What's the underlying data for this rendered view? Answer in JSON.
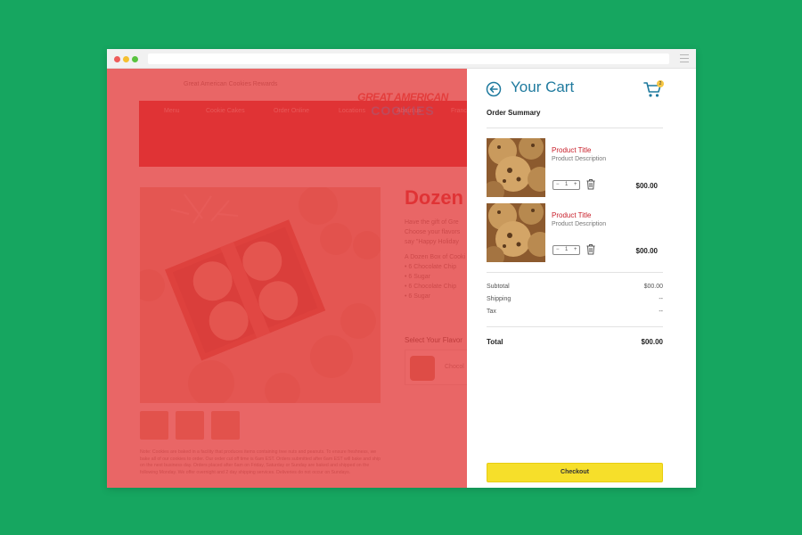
{
  "colors": {
    "background": "#16a660",
    "overlay": "#e43c3c",
    "accent_blue": "#1f7a9e",
    "product_red": "#c8202b",
    "checkout_yellow": "#f6df2a"
  },
  "browser": {
    "menu_icon": "hamburger-icon"
  },
  "site": {
    "rewards_link": "Great American Cookies Rewards",
    "logo_line1": "GREAT AMERICAN",
    "logo_line2": "COOKIES",
    "nav": [
      "Menu",
      "Cookie Cakes",
      "Order Online",
      "Locations",
      "About us",
      "Franc"
    ],
    "product_title": "Dozen",
    "desc": [
      "Have the gift of Gre",
      "Choose your flavors",
      "say \"Happy Holiday"
    ],
    "list_intro": "A Dozen Box of Cooki",
    "list": [
      "• 6 Chocolate Chip",
      "• 6 Sugar",
      "• 6 Chocolate Chip",
      "• 6 Sugar"
    ],
    "flavor_label": "Select Your Flavor",
    "flavor_option": "Chocol",
    "note": "Note: Cookies are baked in a facility that produces items containing tree nuts and peanuts. To ensure freshness, we bake all of our cookies to order. Our order cut off time is 6am EST. Orders submitted after 6am EST will bake and ship on the next business day. Orders placed after 6am on Friday, Saturday or Sunday are baked and shipped on the following Monday. We offer overnight and 2 day shipping services. Deliveries do not occur on Sundays."
  },
  "cart": {
    "title": "Your Cart",
    "badge_count": "2",
    "order_summary": "Order Summary",
    "items": [
      {
        "title": "Product Title",
        "description": "Product Description",
        "qty": "1",
        "price": "$00.00"
      },
      {
        "title": "Product Title",
        "description": "Product Description",
        "qty": "1",
        "price": "$00.00"
      }
    ],
    "stepper_minus": "−",
    "stepper_plus": "+",
    "subtotal_label": "Subtotal",
    "subtotal_value": "$00.00",
    "shipping_label": "Shipping",
    "shipping_value": "--",
    "tax_label": "Tax",
    "tax_value": "--",
    "total_label": "Total",
    "total_value": "$00.00",
    "checkout_label": "Checkout"
  }
}
